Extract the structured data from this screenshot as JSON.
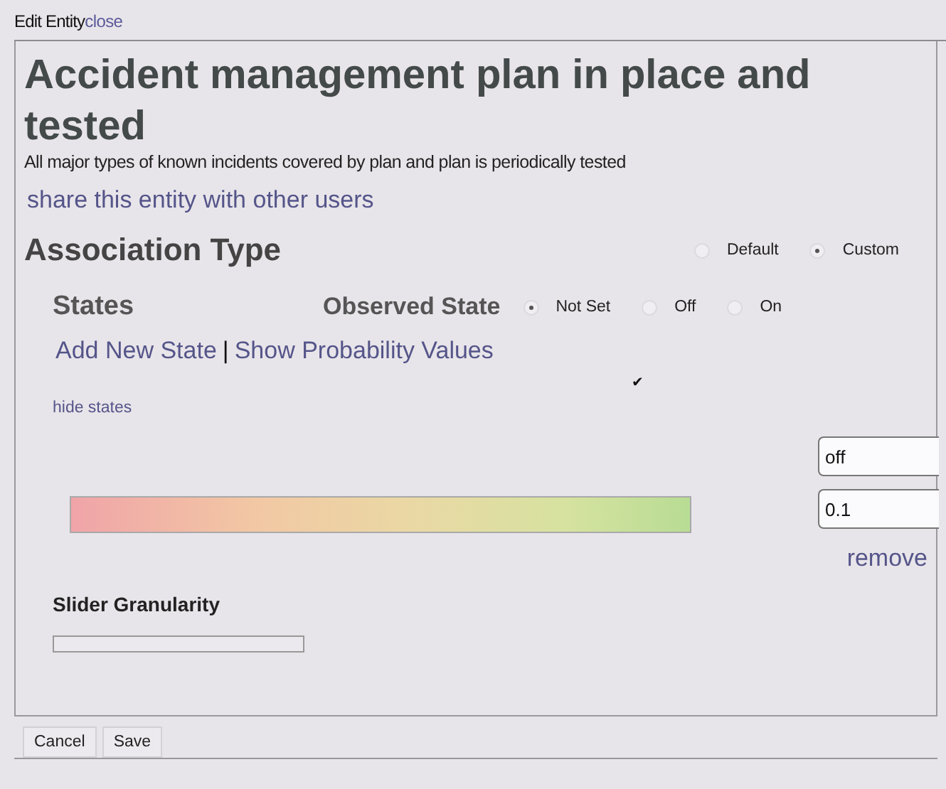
{
  "window": {
    "title": "Edit Entity",
    "close": "close"
  },
  "entity": {
    "title": "Accident management plan in place and tested",
    "description": "All major types of known incidents covered by plan and plan is periodically tested",
    "share_link": "share this entity with other users"
  },
  "association_type": {
    "label": "Association Type",
    "options": [
      {
        "label": "Default",
        "selected": false
      },
      {
        "label": "Custom",
        "selected": true
      }
    ]
  },
  "states": {
    "label": "States",
    "observed_label": "Observed State",
    "observed_options": [
      {
        "label": "Not Set",
        "selected": true
      },
      {
        "label": "Off",
        "selected": false
      },
      {
        "label": "On",
        "selected": false
      }
    ],
    "add_link": "Add New State",
    "separator": "|",
    "show_link": "Show Probability Values",
    "check_mark": "✔",
    "hide_link": "hide states",
    "state_name": "off",
    "state_value": "0.1",
    "remove_link": "remove"
  },
  "slider_granularity": {
    "label": "Slider Granularity"
  },
  "buttons": [
    "Cancel",
    "Save"
  ]
}
